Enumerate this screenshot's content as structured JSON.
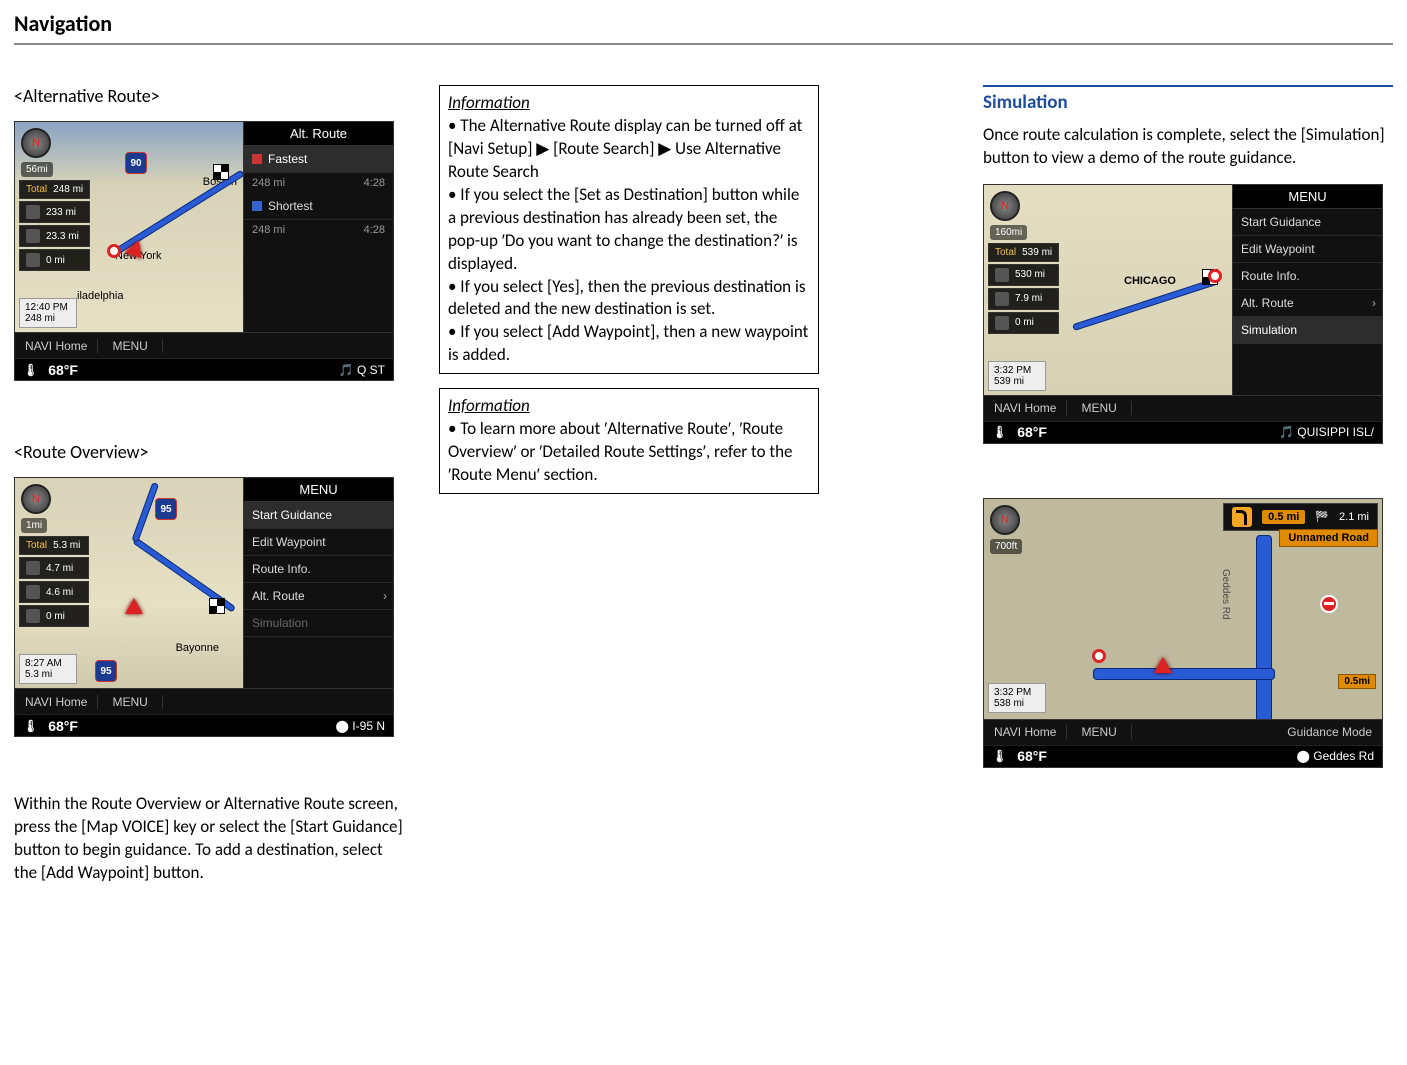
{
  "page_title": "Navigation",
  "col1": {
    "alt_route_heading": "<Alternative Route>",
    "route_overview_heading": "<Route Overview>",
    "overview_paragraph": "Within the Route Overview or Alternative Route screen, press the [Map VOICE] key or select the [Start Guidance] button to begin guidance. To add a destination, select the [Add Waypoint] button."
  },
  "col2": {
    "info1_label": "Information",
    "info1_body": "• The Alternative Route display can be turned off at [Navi Setup] ▶ [Route Search] ▶ Use Alternative Route Search\n• If you select the [Set as Destination] button while a previous destination has already been set, the pop-up ′Do you want to change the destination?′ is displayed.\n• If you select [Yes], then the previous destination is deleted and the new destination is set.\n• If you select [Add Waypoint], then a new waypoint is added.",
    "info2_label": "Information",
    "info2_body": "• To learn more about ′Alternative Route′, ′Route Overview′ or ′Detailed Route Settings′, refer to the ′Route Menu′ section."
  },
  "col3": {
    "sim_title": "Simulation",
    "sim_paragraph": "Once route calculation is complete, select the [Simulation] button to view a demo of the route guidance."
  },
  "fig_altroute": {
    "panel_title": "Alt. Route",
    "fastest": "Fastest",
    "shortest": "Shortest",
    "row1_dist": "248 mi",
    "row1_time": "4:28",
    "row2_dist": "248 mi",
    "row2_time": "4:28",
    "scale": "56mi",
    "stats": [
      {
        "label": "Total",
        "value": "248 mi",
        "cls": "total"
      },
      {
        "label": "",
        "value": "233 mi"
      },
      {
        "label": "",
        "value": "23.3 mi"
      },
      {
        "label": "",
        "value": "0 mi"
      }
    ],
    "time": "12:40 PM",
    "dist": "248 mi",
    "city1": "Boston",
    "city2": "New York",
    "city3": "iladelphia",
    "hwy": "90",
    "navhome": "NAVI Home",
    "menu": "MENU",
    "temp": "68°F",
    "status": "🎵 Q ST"
  },
  "fig_overview": {
    "panel_title": "MENU",
    "items": [
      {
        "label": "Start Guidance",
        "cls": "highlight"
      },
      {
        "label": "Edit Waypoint"
      },
      {
        "label": "Route Info."
      },
      {
        "label": "Alt. Route",
        "chev": true
      },
      {
        "label": "Simulation",
        "cls": "dim"
      }
    ],
    "scale": "1mi",
    "stats": [
      {
        "label": "Total",
        "value": "5.3 mi",
        "cls": "total"
      },
      {
        "label": "",
        "value": "4.7 mi"
      },
      {
        "label": "",
        "value": "4.6 mi"
      },
      {
        "label": "",
        "value": "0 mi"
      }
    ],
    "time": "8:27 AM",
    "dist": "5.3 mi",
    "hwy": "95",
    "city": "Bayonne",
    "navhome": "NAVI Home",
    "menu": "MENU",
    "temp": "68°F",
    "status": "⬤ I-95 N"
  },
  "fig_sim_menu": {
    "panel_title": "MENU",
    "items": [
      {
        "label": "Start Guidance"
      },
      {
        "label": "Edit Waypoint"
      },
      {
        "label": "Route Info."
      },
      {
        "label": "Alt. Route",
        "chev": true
      },
      {
        "label": "Simulation",
        "cls": "highlight"
      }
    ],
    "scale": "160mi",
    "stats": [
      {
        "label": "Total",
        "value": "539 mi",
        "cls": "total"
      },
      {
        "label": "",
        "value": "530 mi"
      },
      {
        "label": "",
        "value": "7.9 mi"
      },
      {
        "label": "",
        "value": "0 mi"
      }
    ],
    "time": "3:32 PM",
    "dist": "539 mi",
    "city": "CHICAGO",
    "navhome": "NAVI Home",
    "menu": "MENU",
    "temp": "68°F",
    "status": "🎵 QUISIPPI ISL/"
  },
  "fig_sim_run": {
    "banner_dist": "0.5 mi",
    "banner_total": "2.1 mi",
    "unnamed": "Unnamed Road",
    "scale": "700ft",
    "road": "Geddes Rd",
    "mini": "0.5mi",
    "time": "3:32 PM",
    "dist": "538 mi",
    "navhome": "NAVI Home",
    "menu": "MENU",
    "gmode": "Guidance Mode",
    "temp": "68°F",
    "status": "⬤ Geddes Rd"
  }
}
